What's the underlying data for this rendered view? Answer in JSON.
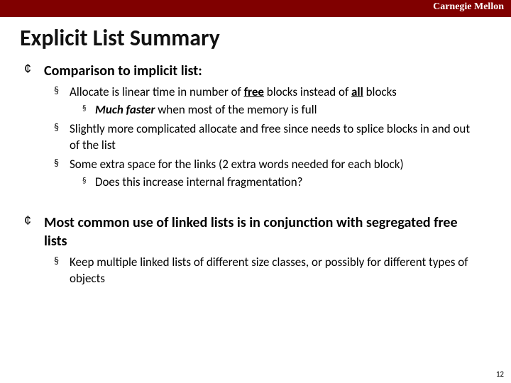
{
  "brand": "Carnegie Mellon",
  "title": "Explicit List Summary",
  "bullets": {
    "b1": {
      "label": "Comparison to implicit list:",
      "s1_pre": "Allocate is linear time in number of ",
      "s1_free": "free",
      "s1_mid": " blocks instead of ",
      "s1_all": "all",
      "s1_post": " blocks",
      "s1a_pre": "Much faster",
      "s1a_post": " when most of the memory is full",
      "s2": "Slightly more complicated allocate and free since needs to splice blocks in and out of the list",
      "s3": "Some extra space for the links (2 extra  words needed for each block)",
      "s3a": "Does this increase internal fragmentation?"
    },
    "b2": {
      "label": "Most common use of linked lists is in conjunction with segregated free lists",
      "s1": "Keep multiple linked lists of different size classes, or possibly for different types of objects"
    }
  },
  "page_number": "12"
}
